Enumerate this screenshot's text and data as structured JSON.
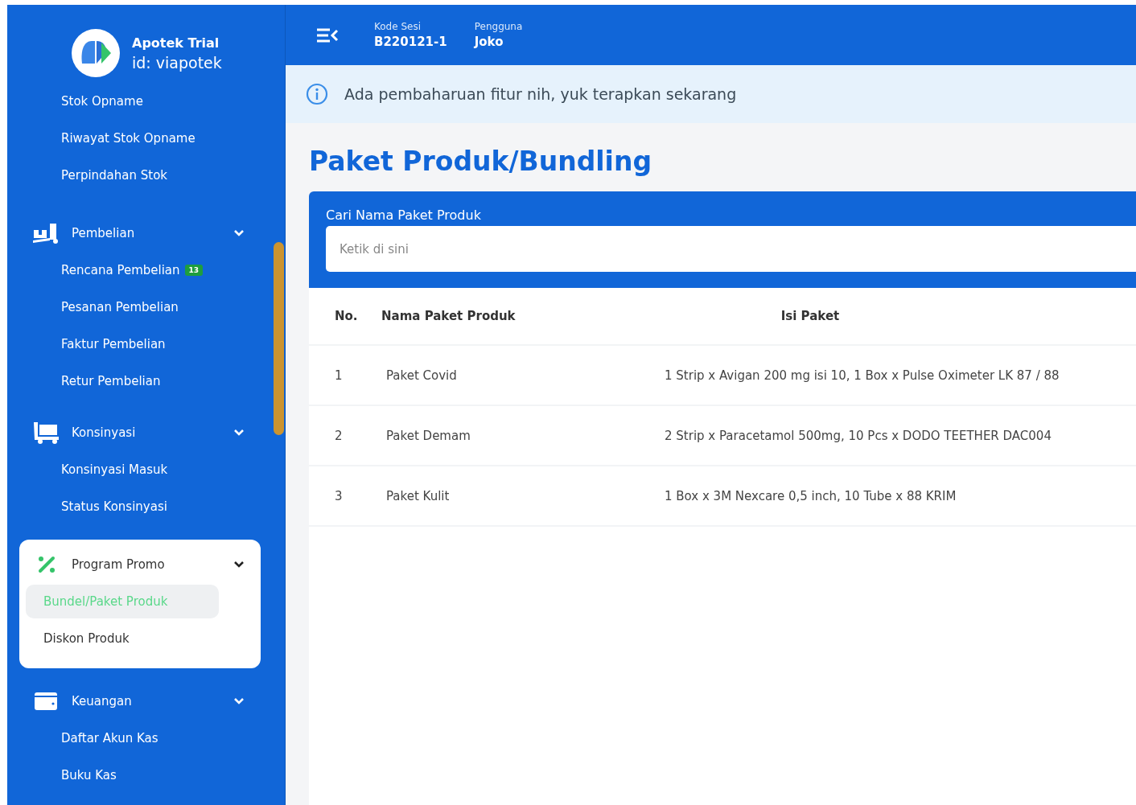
{
  "brand": {
    "name": "Apotek Trial",
    "id": "id: viapotek"
  },
  "sidebar": {
    "sections": [
      {
        "kind": "plain",
        "children": [
          {
            "label": "Stok Opname",
            "selected": false
          },
          {
            "label": "Riwayat Stok Opname",
            "selected": false
          },
          {
            "label": "Perpindahan Stok",
            "selected": false
          }
        ]
      },
      {
        "kind": "group",
        "label": "Pembelian",
        "expanded": true,
        "active": false,
        "children": [
          {
            "label": "Rencana Pembelian",
            "badge": "13",
            "selected": false
          },
          {
            "label": "Pesanan Pembelian",
            "selected": false
          },
          {
            "label": "Faktur Pembelian",
            "selected": false
          },
          {
            "label": "Retur Pembelian",
            "selected": false
          }
        ]
      },
      {
        "kind": "group",
        "label": "Konsinyasi",
        "expanded": true,
        "active": false,
        "children": [
          {
            "label": "Konsinyasi Masuk",
            "selected": false
          },
          {
            "label": "Status Konsinyasi",
            "selected": false
          }
        ]
      },
      {
        "kind": "group",
        "label": "Program Promo",
        "expanded": true,
        "active": true,
        "children": [
          {
            "label": "Bundel/Paket Produk",
            "selected": true
          },
          {
            "label": "Diskon Produk",
            "selected": false
          }
        ]
      },
      {
        "kind": "group",
        "label": "Keuangan",
        "expanded": true,
        "active": false,
        "children": [
          {
            "label": "Daftar Akun Kas",
            "selected": false
          },
          {
            "label": "Buku Kas",
            "selected": false
          }
        ]
      }
    ]
  },
  "topbar": {
    "fields": [
      {
        "label": "Kode Sesi",
        "value": "B220121-1"
      },
      {
        "label": "Pengguna",
        "value": "Joko"
      }
    ]
  },
  "alert": {
    "text": "Ada pembaharuan fitur nih, yuk terapkan sekarang"
  },
  "page_title": "Paket Produk/Bundling",
  "search": {
    "label": "Cari Nama Paket Produk",
    "placeholder": "Ketik di sini"
  },
  "table": {
    "columns": [
      "No.",
      "Nama Paket Produk",
      "Isi Paket"
    ],
    "rows": [
      [
        "1",
        "Paket Covid",
        "1 Strip x Avigan 200 mg isi 10, 1 Box x Pulse Oximeter LK 87 / 88"
      ],
      [
        "2",
        "Paket Demam",
        "2 Strip x Paracetamol 500mg, 10 Pcs x DODO TEETHER DAC004"
      ],
      [
        "3",
        "Paket Kulit",
        "1 Box x 3M Nexcare 0,5 inch, 10 Tube x 88 KRIM"
      ]
    ]
  }
}
